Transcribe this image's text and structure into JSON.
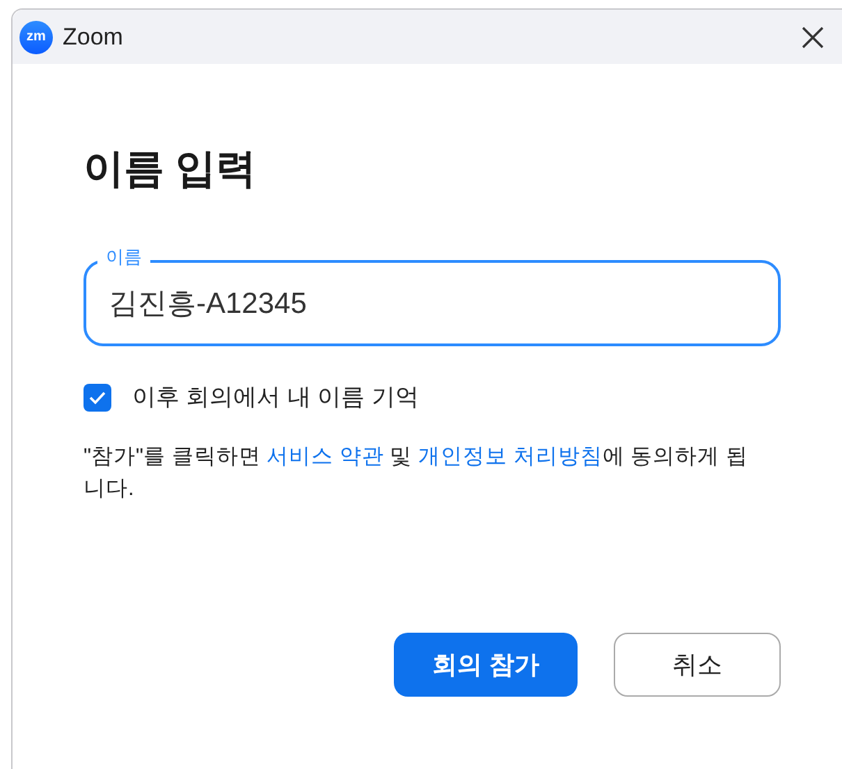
{
  "window": {
    "title": "Zoom",
    "logo_text": "zm"
  },
  "heading": "이름 입력",
  "name_field": {
    "label": "이름",
    "value": "김진흥-A12345",
    "focused": true
  },
  "remember": {
    "label": "이후 회의에서 내 이름 기억",
    "checked": true
  },
  "terms": [
    {
      "kind": "text",
      "text": "\"참가\"를 클릭하면 "
    },
    {
      "kind": "link",
      "text": "서비스 약관"
    },
    {
      "kind": "text",
      "text": " 및 "
    },
    {
      "kind": "link",
      "text": "개인정보 처리방침"
    },
    {
      "kind": "text",
      "text": "에 동의하게 됩니다."
    }
  ],
  "buttons": [
    {
      "kind": "primary",
      "label": "회의 참가"
    },
    {
      "kind": "secondary",
      "label": "취소"
    }
  ]
}
